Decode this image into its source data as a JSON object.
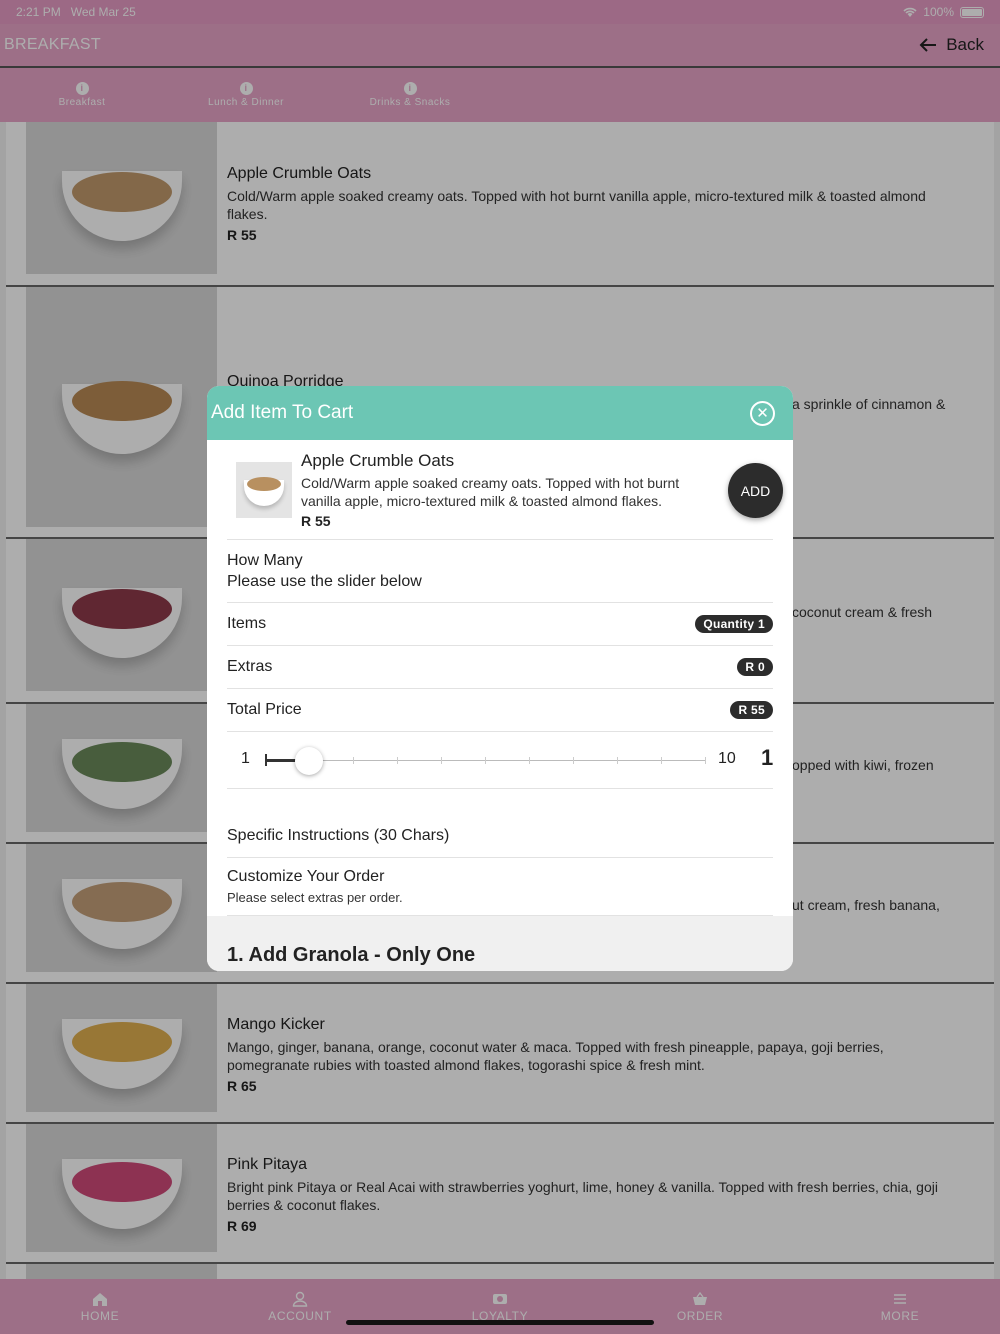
{
  "status_bar": {
    "time": "2:21 PM",
    "date": "Wed Mar 25",
    "battery": "100%"
  },
  "header": {
    "title": "BREAKFAST",
    "back_label": "Back"
  },
  "category_tabs": [
    {
      "label": "Breakfast"
    },
    {
      "label": "Lunch & Dinner"
    },
    {
      "label": "Drinks & Snacks"
    }
  ],
  "menu": [
    {
      "name": "Apple Crumble Oats",
      "desc": "Cold/Warm apple soaked creamy oats. Topped with hot burnt vanilla apple, micro-textured milk & toasted almond flakes.",
      "price": "R 55"
    },
    {
      "name": "Quinoa Porridge",
      "desc": "a sprinkle of cinnamon &",
      "price": ""
    },
    {
      "name": "",
      "desc": "coconut cream & fresh",
      "price": ""
    },
    {
      "name": "",
      "desc": "opped with kiwi, frozen",
      "price": ""
    },
    {
      "name": "",
      "desc": "ut cream, fresh banana,",
      "price": ""
    },
    {
      "name": "Mango Kicker",
      "desc": "Mango, ginger, banana, orange, coconut water & maca. Topped with fresh pineapple, papaya, goji berries, pomegranate rubies with toasted almond flakes, togorashi spice & fresh mint.",
      "price": "R 65"
    },
    {
      "name": "Pink Pitaya",
      "desc": "Bright pink Pitaya or Real Acai with strawberries yoghurt, lime, honey & vanilla. Topped with fresh berries, chia, goji berries & coconut flakes.",
      "price": "R 69"
    }
  ],
  "modal": {
    "title": "Add Item To Cart",
    "product": {
      "name": "Apple Crumble Oats",
      "desc": "Cold/Warm apple soaked creamy oats. Topped with hot burnt vanilla apple, micro-textured milk & toasted almond flakes.",
      "price": "R 55"
    },
    "add_label": "ADD",
    "how_many_title": "How Many",
    "how_many_hint": "Please use the slider below",
    "items_label": "Items",
    "items_value": "Quantity 1",
    "extras_label": "Extras",
    "extras_value": "R 0",
    "total_label": "Total Price",
    "total_value": "R 55",
    "slider": {
      "min": "1",
      "max": "10",
      "value": "1",
      "min_num": 1,
      "max_num": 10,
      "value_num": 1
    },
    "instructions_label": "Specific Instructions (30 Chars)",
    "customize_title": "Customize Your Order",
    "customize_hint": "Please select extras per order.",
    "section_title": "1. Add Granola - Only One"
  },
  "tab_bar": [
    {
      "label": "HOME",
      "icon": "home-icon"
    },
    {
      "label": "ACCOUNT",
      "icon": "person-icon"
    },
    {
      "label": "LOYALTY",
      "icon": "loyalty-icon"
    },
    {
      "label": "ORDER",
      "icon": "basket-icon"
    },
    {
      "label": "MORE",
      "icon": "menu-icon"
    }
  ],
  "colors": {
    "brand_pink": "#e7a4c8",
    "modal_header": "#6cc6b4",
    "pill_dark": "#2c2c2c"
  }
}
